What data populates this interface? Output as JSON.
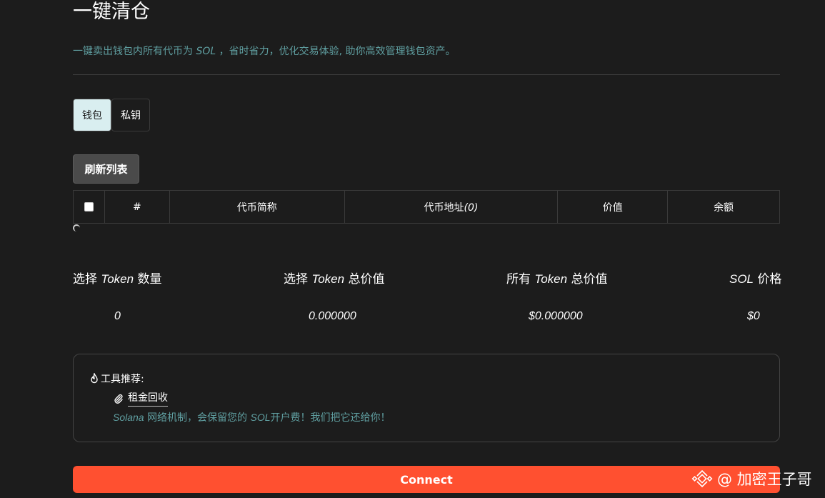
{
  "header": {
    "title": "一键清仓",
    "subtitle_pre": "一键卖出钱包内所有代币为 ",
    "subtitle_sol": "SOL",
    "subtitle_post": " ，省时省力，优化交易体验, 助你高效管理钱包资产。"
  },
  "tabs": [
    {
      "label": "钱包",
      "active": true
    },
    {
      "label": "私钥",
      "active": false
    }
  ],
  "toolbar": {
    "refresh_label": "刷新列表"
  },
  "table": {
    "columns": {
      "index": "#",
      "token_name": "代币简称",
      "token_address": "代币地址",
      "token_address_count": "(0)",
      "value": "价值",
      "balance": "余额"
    }
  },
  "stats": {
    "selected_count": {
      "pre": "选择 ",
      "token": "Token",
      "post": " 数量",
      "value": "0"
    },
    "selected_total": {
      "pre": "选择 ",
      "token": "Token",
      "post": " 总价值",
      "value": "0.000000"
    },
    "all_total": {
      "pre": "所有 ",
      "token": "Token",
      "post": " 总价值",
      "value": "$0.000000"
    },
    "sol_price": {
      "pre": "",
      "token": "SOL",
      "post": " 价格",
      "value": "$0"
    }
  },
  "tools": {
    "title": "工具推荐:",
    "link_label": "租金回收",
    "desc_sol1": "Solana",
    "desc_mid": " 网络机制，会保留您的 ",
    "desc_sol2": "SOL",
    "desc_post": "开户费！我们把它还给你！"
  },
  "connect": {
    "label": "Connect"
  },
  "watermark": {
    "text": "@ 加密王子哥"
  },
  "colors": {
    "background": "#1c1c1c",
    "accent_teal": "#5f9ea0",
    "connect": "#ff5030",
    "tab_active": "#d9eef0",
    "refresh": "#4a4a4a"
  },
  "icons": [
    "flame-icon",
    "paperclip-icon",
    "binance-logo-icon",
    "loading-spinner-icon"
  ]
}
